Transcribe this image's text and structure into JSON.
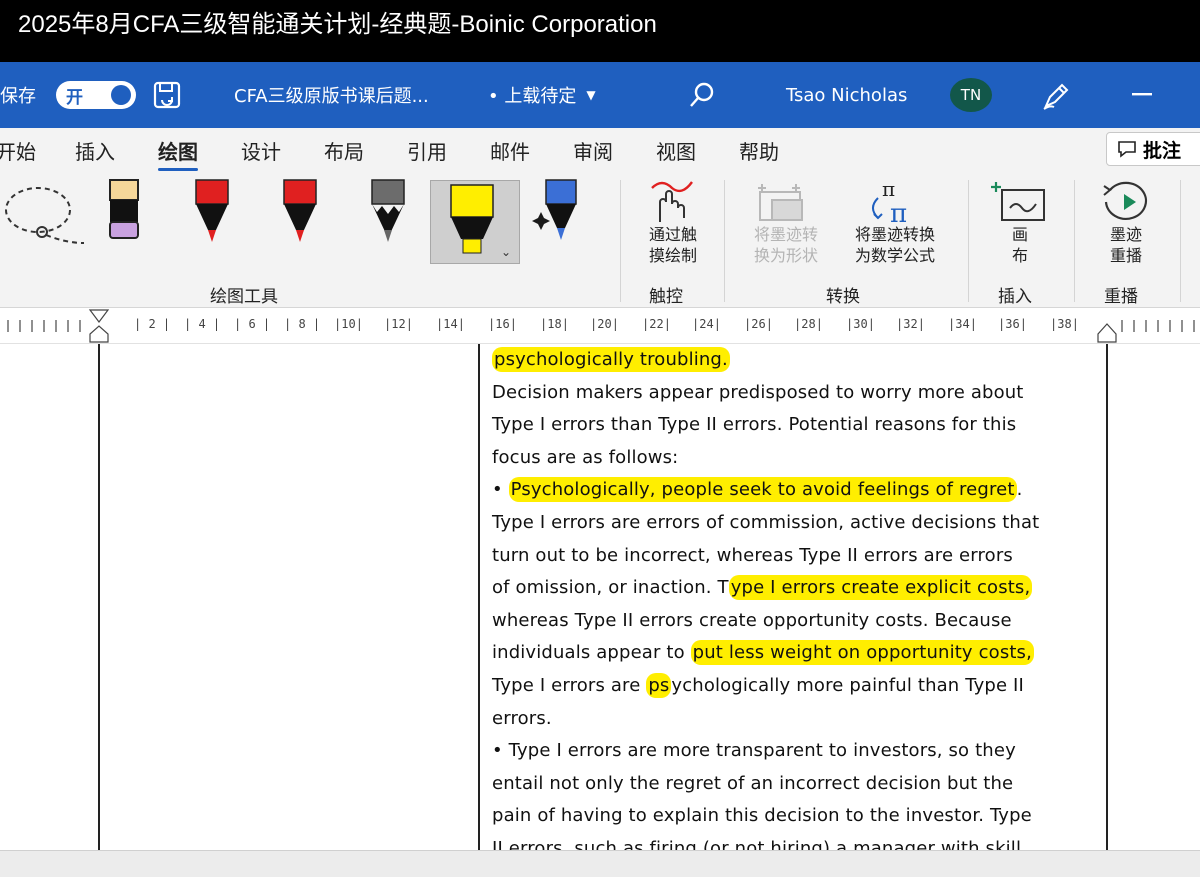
{
  "video_title": "2025年8月CFA三级智能通关计划-经典题-Boinic Corporation",
  "titlebar": {
    "autosave_label": "保存",
    "toggle_label": "开",
    "doc_name": "CFA三级原版书课后题...",
    "upload_status": "• 上载待定",
    "user_name": "Tsao Nicholas",
    "avatar_initials": "TN"
  },
  "tabs": [
    "开始",
    "插入",
    "绘图",
    "设计",
    "布局",
    "引用",
    "邮件",
    "审阅",
    "视图",
    "帮助"
  ],
  "active_tab": "绘图",
  "comment_button": "批注",
  "ribbon": {
    "groups": {
      "drawing_tools": "绘图工具",
      "touch": "触控",
      "convert": "转换",
      "insert": "插入",
      "replay": "重播"
    },
    "buttons": {
      "draw_touch": [
        "通过触",
        "摸绘制"
      ],
      "ink_to_shape": [
        "将墨迹转",
        "换为形状"
      ],
      "ink_to_math": [
        "将墨迹转换",
        "为数学公式"
      ],
      "canvas": [
        "画",
        "布"
      ],
      "ink_replay": [
        "墨迹",
        "重播"
      ]
    }
  },
  "ruler_numbers": [
    "2",
    "4",
    "6",
    "8",
    "10",
    "12",
    "14",
    "16",
    "18",
    "20",
    "22",
    "24",
    "26",
    "28",
    "30",
    "32",
    "34",
    "36",
    "38"
  ],
  "colors": {
    "title_bar": "#1f5fbf",
    "highlight": "#ffee00",
    "avatar": "#12574a"
  },
  "document": {
    "lines": [
      [
        {
          "t": "psychologically troubling.",
          "h": true
        }
      ],
      [
        {
          "t": "Decision makers appear predisposed to worry more about",
          "h": false
        }
      ],
      [
        {
          "t": "Type I errors than Type II errors. Potential reasons for this",
          "h": false
        }
      ],
      [
        {
          "t": "focus are as follows:",
          "h": false
        }
      ],
      [
        {
          "t": "•  ",
          "h": false
        },
        {
          "t": "Psychologically, people seek to avoid feelings of regret",
          "h": true
        },
        {
          "t": ".",
          "h": false
        }
      ],
      [
        {
          "t": "Type I errors are errors of commission, active decisions that",
          "h": false
        }
      ],
      [
        {
          "t": "turn out to be incorrect, whereas Type II errors are errors",
          "h": false
        }
      ],
      [
        {
          "t": "of omission, or inaction. T",
          "h": false
        },
        {
          "t": "ype I errors create explicit costs,",
          "h": true
        }
      ],
      [
        {
          "t": "whereas Type II errors create opportunity costs. Because",
          "h": false
        }
      ],
      [
        {
          "t": "individuals appear to ",
          "h": false
        },
        {
          "t": "put less weight on opportunity costs,",
          "h": true
        }
      ],
      [
        {
          "t": "Type I errors are ",
          "h": false
        },
        {
          "t": "ps",
          "h": true
        },
        {
          "t": "ychologically more painful than Type II",
          "h": false
        }
      ],
      [
        {
          "t": "errors.",
          "h": false
        }
      ],
      [
        {
          "t": "•  Type I errors are more transparent to investors, so they",
          "h": false
        }
      ],
      [
        {
          "t": "entail not only the regret of an incorrect decision but the",
          "h": false
        }
      ],
      [
        {
          "t": "pain of having to explain this decision to the investor. Type",
          "h": false
        }
      ],
      [
        {
          "t": "II errors, such as firing (or not hiring) a manager with skill,",
          "h": false
        }
      ]
    ]
  }
}
